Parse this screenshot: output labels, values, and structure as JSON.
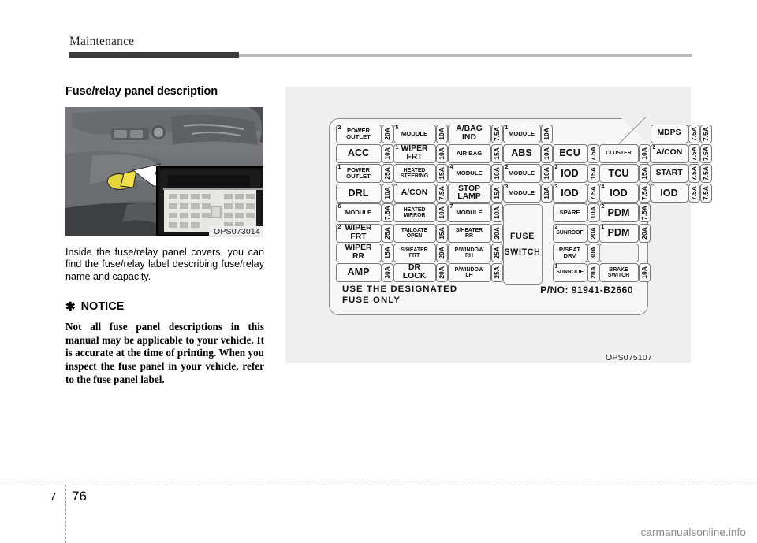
{
  "header": {
    "chapter": "Maintenance"
  },
  "left": {
    "heading": "Fuse/relay panel description",
    "photo_caption": "OPS073014",
    "body": "Inside the fuse/relay panel covers, you can find the fuse/relay label describing fuse/relay name and capacity.",
    "notice_star": "✱",
    "notice_title": "NOTICE",
    "notice_body": "Not all fuse panel descriptions in this manual may be applicable to your vehicle. It is accurate at the time of printing. When you inspect the fuse panel in your vehicle, refer to the fuse panel label."
  },
  "diagram": {
    "caption": "OPS075107",
    "designated_note_line1": "USE THE DESIGNATED",
    "designated_note_line2": "FUSE ONLY",
    "part_number": "P/NO: 91941-B2660",
    "fuse_switch_line1": "FUSE",
    "fuse_switch_line2": "SWITCH",
    "columns": [
      {
        "kind": "name",
        "width": 58,
        "cells": [
          {
            "sup": "2",
            "text": "POWER\nOUTLET",
            "size": "t-sm",
            "h": 24
          },
          {
            "sup": "",
            "text": "ACC",
            "size": "t-lg",
            "h": 24
          },
          {
            "sup": "1",
            "text": "POWER\nOUTLET",
            "size": "t-sm",
            "h": 24
          },
          {
            "sup": "",
            "text": "DRL",
            "size": "t-lg",
            "h": 24
          },
          {
            "sup": "6",
            "text": "MODULE",
            "size": "t-sm",
            "h": 24
          },
          {
            "sup": "2",
            "text": "WIPER\nFRT",
            "size": "t-md",
            "h": 24
          },
          {
            "sup": "",
            "text": "WIPER\nRR",
            "size": "t-md",
            "h": 24
          },
          {
            "sup": "",
            "text": "AMP",
            "size": "t-lg",
            "h": 24
          }
        ]
      },
      {
        "kind": "amp",
        "width": 15,
        "cells": [
          {
            "text": "20A",
            "h": 24
          },
          {
            "text": "10A",
            "h": 24
          },
          {
            "text": "25A",
            "h": 24
          },
          {
            "text": "10A",
            "h": 24
          },
          {
            "text": "7.5A",
            "h": 24
          },
          {
            "text": "25A",
            "h": 24
          },
          {
            "text": "15A",
            "h": 24
          },
          {
            "text": "30A",
            "h": 24
          }
        ]
      },
      {
        "kind": "name",
        "width": 54,
        "cells": [
          {
            "sup": "5",
            "text": "MODULE",
            "size": "t-sm",
            "h": 24
          },
          {
            "sup": "1",
            "text": "WIPER\nFRT",
            "size": "t-md",
            "h": 24
          },
          {
            "sup": "",
            "text": "HEATED\nSTEERING",
            "size": "t-xs",
            "h": 24
          },
          {
            "sup": "1",
            "text": "A/CON",
            "size": "t-md",
            "h": 24
          },
          {
            "sup": "",
            "text": "HEATED\nMIRROR",
            "size": "t-xs",
            "h": 24
          },
          {
            "sup": "",
            "text": "TAILGATE\nOPEN",
            "size": "t-xs",
            "h": 24
          },
          {
            "sup": "",
            "text": "S/HEATER\nFRT",
            "size": "t-xs",
            "h": 24
          },
          {
            "sup": "",
            "text": "DR\nLOCK",
            "size": "t-md",
            "h": 24
          }
        ]
      },
      {
        "kind": "amp",
        "width": 15,
        "cells": [
          {
            "text": "10A",
            "h": 24
          },
          {
            "text": "10A",
            "h": 24
          },
          {
            "text": "15A",
            "h": 24
          },
          {
            "text": "7.5A",
            "h": 24
          },
          {
            "text": "10A",
            "h": 24
          },
          {
            "text": "15A",
            "h": 24
          },
          {
            "text": "20A",
            "h": 24
          },
          {
            "text": "20A",
            "h": 24
          }
        ]
      },
      {
        "kind": "name",
        "width": 55,
        "cells": [
          {
            "sup": "",
            "text": "A/BAG\nIND",
            "size": "t-md",
            "h": 24
          },
          {
            "sup": "",
            "text": "AIR BAG",
            "size": "t-sm",
            "h": 24
          },
          {
            "sup": "4",
            "text": "MODULE",
            "size": "t-sm",
            "h": 24
          },
          {
            "sup": "",
            "text": "STOP\nLAMP",
            "size": "t-md",
            "h": 24
          },
          {
            "sup": "7",
            "text": "MODULE",
            "size": "t-sm",
            "h": 24
          },
          {
            "sup": "",
            "text": "S/HEATER\nRR",
            "size": "t-xs",
            "h": 24
          },
          {
            "sup": "",
            "text": "P/WINDOW\nRH",
            "size": "t-xs",
            "h": 24
          },
          {
            "sup": "",
            "text": "P/WINDOW\nLH",
            "size": "t-xs",
            "h": 24
          }
        ]
      },
      {
        "kind": "amp",
        "width": 15,
        "cells": [
          {
            "text": "7.5A",
            "h": 24
          },
          {
            "text": "15A",
            "h": 24
          },
          {
            "text": "10A",
            "h": 24
          },
          {
            "text": "15A",
            "h": 24
          },
          {
            "text": "10A",
            "h": 24
          },
          {
            "text": "20A",
            "h": 24
          },
          {
            "text": "25A",
            "h": 24
          },
          {
            "text": "25A",
            "h": 24
          }
        ]
      },
      {
        "kind": "name",
        "width": 48,
        "cells": [
          {
            "sup": "1",
            "text": "MODULE",
            "size": "t-sm",
            "h": 24
          },
          {
            "sup": "",
            "text": "ABS",
            "size": "t-lg",
            "h": 24
          },
          {
            "sup": "2",
            "text": "MODULE",
            "size": "t-sm",
            "h": 24
          },
          {
            "sup": "3",
            "text": "MODULE",
            "size": "t-sm",
            "h": 24
          },
          {
            "kind": "switch",
            "h": 100
          }
        ]
      },
      {
        "kind": "amp",
        "width": 15,
        "cells": [
          {
            "text": "10A",
            "h": 24
          },
          {
            "text": "10A",
            "h": 24
          },
          {
            "text": "10A",
            "h": 24
          },
          {
            "text": "10A",
            "h": 24
          }
        ]
      },
      {
        "kind": "name",
        "width": 44,
        "cells": [
          {
            "kind": "gap",
            "h": 24
          },
          {
            "sup": "",
            "text": "ECU",
            "size": "t-lg",
            "h": 24
          },
          {
            "sup": "2",
            "text": "IOD",
            "size": "t-lg",
            "h": 24
          },
          {
            "sup": "3",
            "text": "IOD",
            "size": "t-lg",
            "h": 24
          },
          {
            "sup": "",
            "text": "SPARE",
            "size": "t-sm",
            "h": 24
          },
          {
            "sup": "2",
            "text": "SUNROOF",
            "size": "t-xs",
            "h": 24
          },
          {
            "sup": "",
            "text": "P/SEAT\nDRV",
            "size": "t-sm",
            "h": 24
          },
          {
            "sup": "1",
            "text": "SUNROOF",
            "size": "t-xs",
            "h": 24
          }
        ]
      },
      {
        "kind": "amp",
        "width": 15,
        "cells": [
          {
            "kind": "gap",
            "h": 24
          },
          {
            "text": "7.5A",
            "h": 24
          },
          {
            "text": "15A",
            "h": 24
          },
          {
            "text": "7.5A",
            "h": 24
          },
          {
            "text": "10A",
            "h": 24
          },
          {
            "text": "20A",
            "h": 24
          },
          {
            "text": "30A",
            "h": 24
          },
          {
            "text": "20A",
            "h": 24
          }
        ]
      },
      {
        "kind": "name",
        "width": 50,
        "cells": [
          {
            "kind": "gap",
            "h": 24
          },
          {
            "sup": "",
            "text": "CLUSTER",
            "size": "t-xs",
            "h": 24
          },
          {
            "sup": "",
            "text": "TCU",
            "size": "t-lg",
            "h": 24
          },
          {
            "sup": "4",
            "text": "IOD",
            "size": "t-lg",
            "h": 24
          },
          {
            "sup": "2",
            "text": "PDM",
            "size": "t-lg",
            "h": 24
          },
          {
            "sup": "1",
            "text": "PDM",
            "size": "t-lg",
            "h": 24
          },
          {
            "kind": "blank",
            "h": 24
          },
          {
            "sup": "",
            "text": "BRAKE\nSWITCH",
            "size": "t-xs",
            "h": 24
          }
        ]
      },
      {
        "kind": "amp",
        "width": 15,
        "cells": [
          {
            "kind": "gap",
            "h": 24
          },
          {
            "text": "10A",
            "h": 24
          },
          {
            "text": "15A",
            "h": 24
          },
          {
            "text": "7.5A",
            "h": 24
          },
          {
            "text": "7.5A",
            "h": 24
          },
          {
            "text": "20A",
            "h": 24
          },
          {
            "kind": "gap",
            "h": 24
          },
          {
            "text": "10A",
            "h": 24
          }
        ]
      },
      {
        "kind": "name",
        "width": 48,
        "cells": [
          {
            "sup": "",
            "text": "MDPS",
            "size": "t-md",
            "h": 24
          },
          {
            "sup": "2",
            "text": "A/CON",
            "size": "t-md",
            "h": 24
          },
          {
            "sup": "",
            "text": "START",
            "size": "t-md",
            "h": 24
          },
          {
            "sup": "1",
            "text": "IOD",
            "size": "t-lg",
            "h": 24
          }
        ]
      },
      {
        "kind": "amp",
        "width": 15,
        "cells": [
          {
            "text": "7.5A",
            "h": 24
          },
          {
            "text": "7.5A",
            "h": 24
          },
          {
            "text": "7.5A",
            "h": 24
          },
          {
            "text": "7.5A",
            "h": 24
          }
        ]
      },
      {
        "kind": "amp",
        "width": 15,
        "cells": [
          {
            "text": "7.5A",
            "h": 24
          },
          {
            "text": "7.5A",
            "h": 24
          },
          {
            "text": "7.5A",
            "h": 24
          },
          {
            "text": "7.5A",
            "h": 24
          }
        ]
      }
    ]
  },
  "footer": {
    "chapter_number": "7",
    "page_number": "76",
    "watermark": "carmanualsonline.info"
  }
}
